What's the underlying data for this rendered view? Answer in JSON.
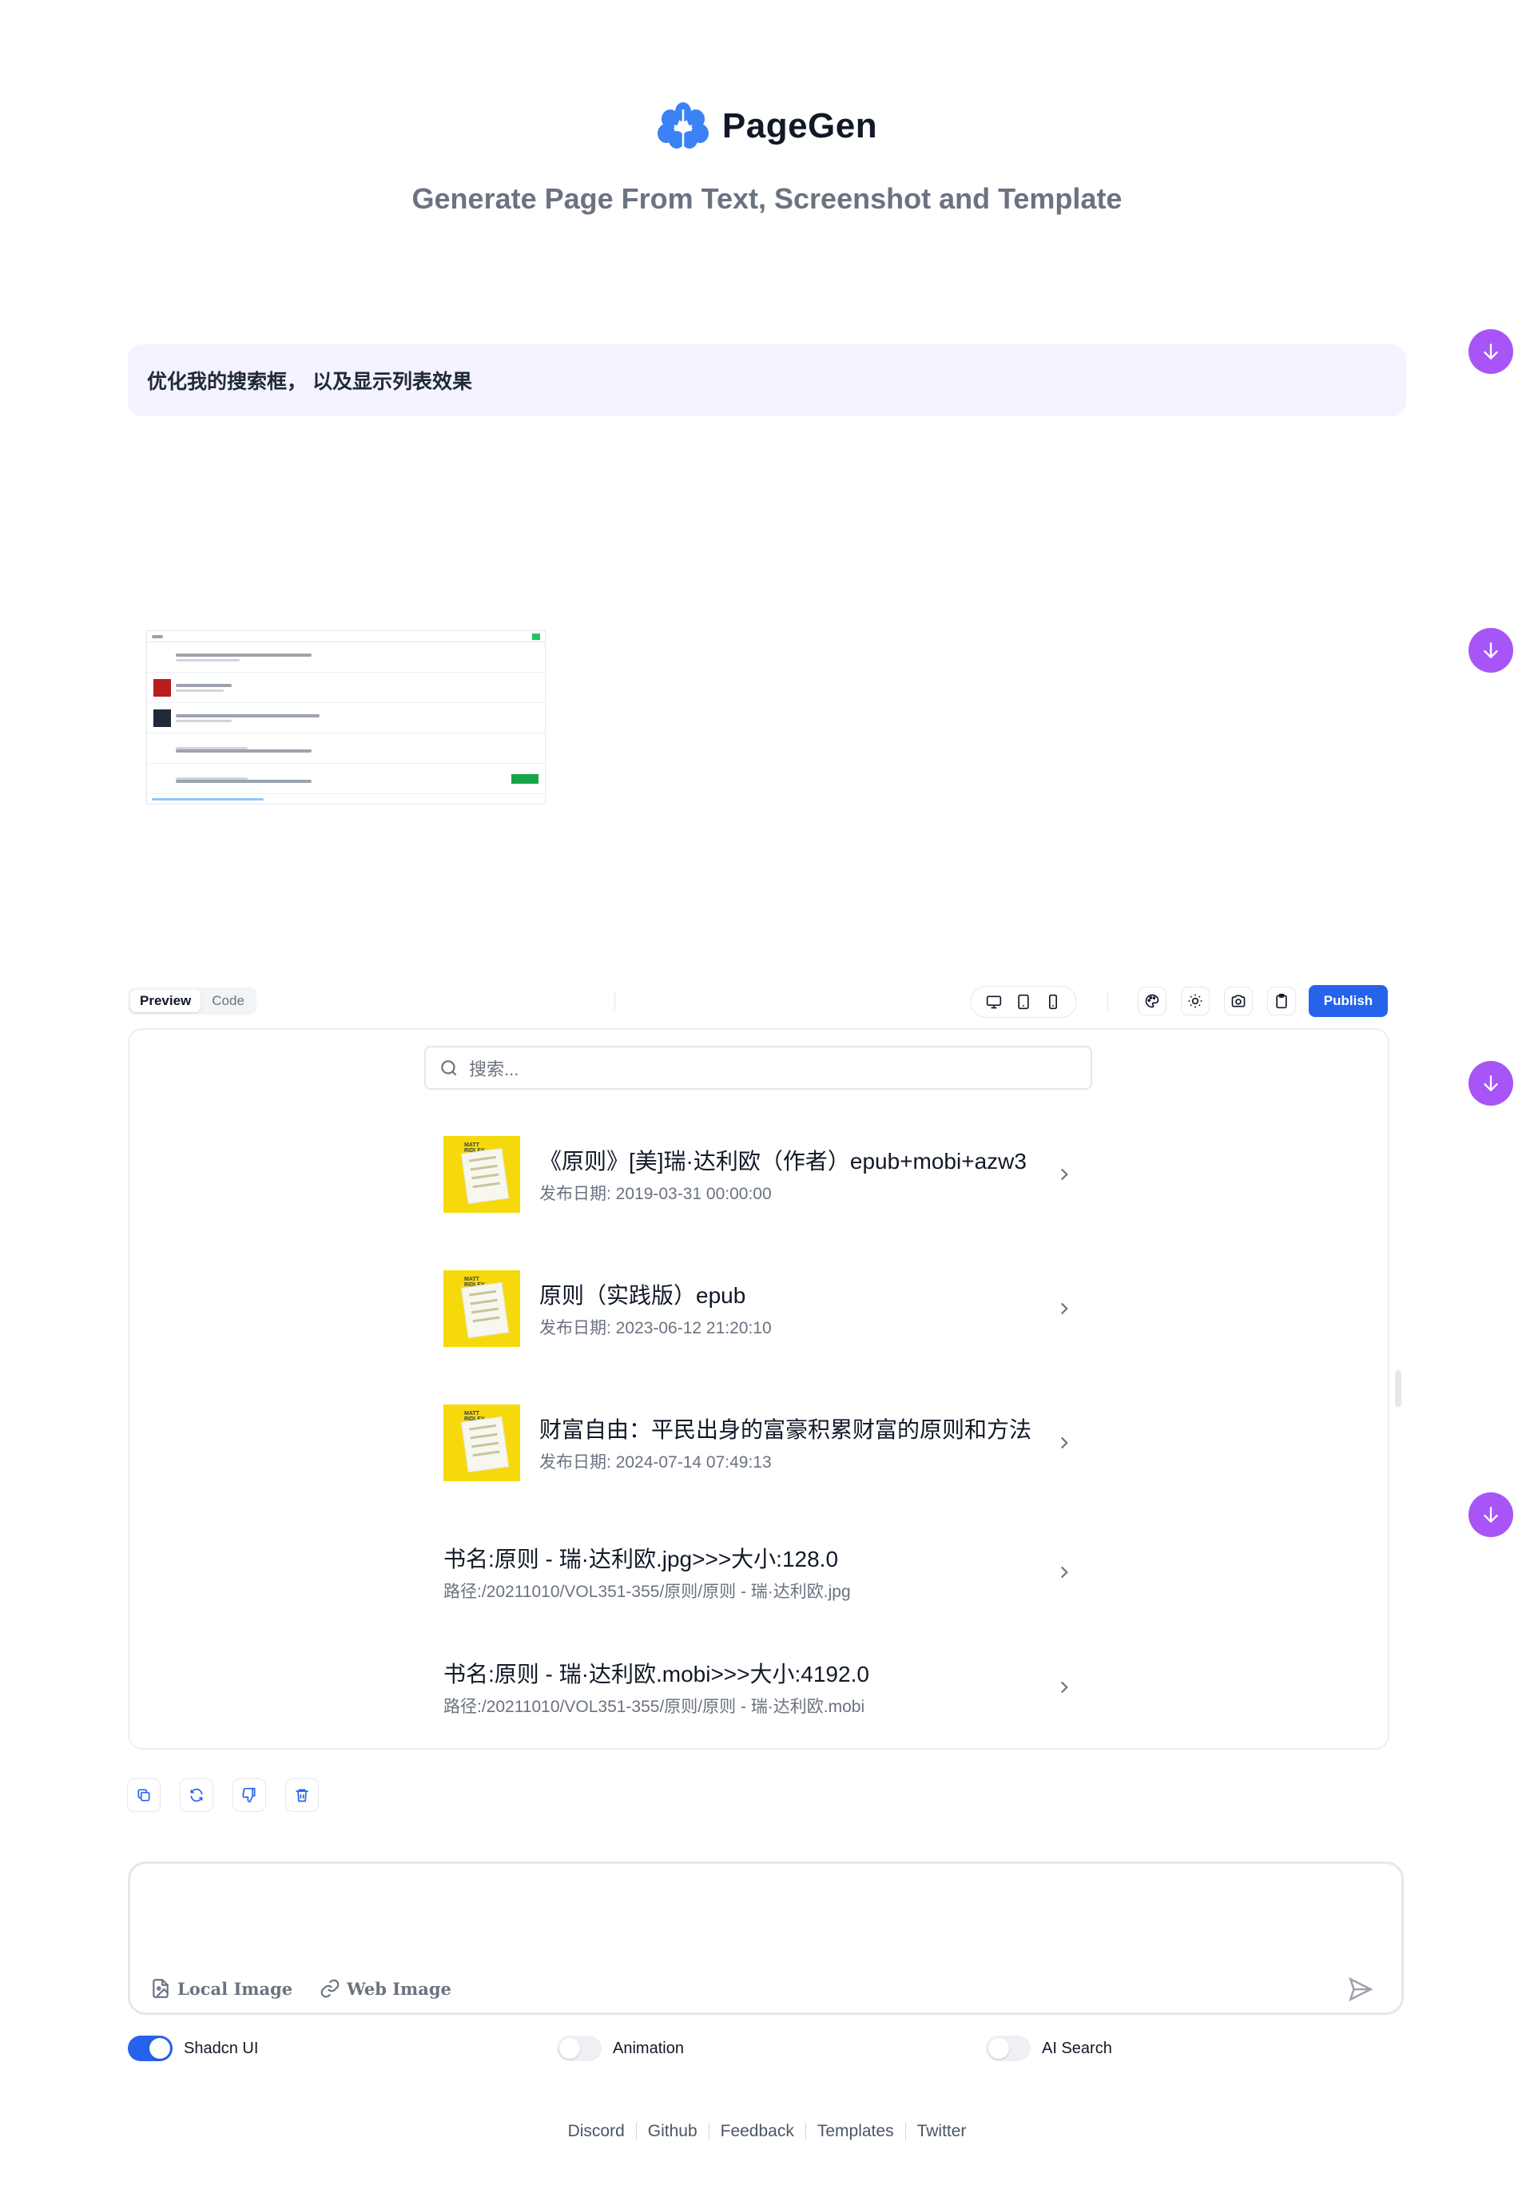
{
  "brand": {
    "name": "PageGen",
    "tagline": "Generate Page From Text, Screenshot and Template"
  },
  "prompt": {
    "text": "优化我的搜索框， 以及显示列表效果"
  },
  "toolbar": {
    "tabs": [
      {
        "label": "Preview",
        "active": true
      },
      {
        "label": "Code",
        "active": false
      }
    ],
    "devices": [
      "monitor-icon",
      "tablet-icon",
      "phone-icon"
    ],
    "tools": [
      "palette-icon",
      "sun-icon",
      "camera-icon",
      "clipboard-icon"
    ],
    "publish_label": "Publish"
  },
  "preview": {
    "search": {
      "placeholder": "搜索..."
    },
    "items": [
      {
        "title": "《原则》[美]瑞·达利欧（作者）epub+mobi+azw3",
        "subtitle": "发布日期: 2019-03-31 00:00:00",
        "has_cover": true
      },
      {
        "title": "原则（实践版）epub",
        "subtitle": "发布日期: 2023-06-12 21:20:10",
        "has_cover": true
      },
      {
        "title": "财富自由：平民出身的富豪积累财富的原则和方法",
        "subtitle": "发布日期: 2024-07-14 07:49:13",
        "has_cover": true
      },
      {
        "title": "书名:原则 - 瑞·达利欧.jpg>>>大小:128.0",
        "subtitle": "路径:/20211010/VOL351-355/原则/原则 - 瑞·达利欧.jpg",
        "has_cover": false
      },
      {
        "title": "书名:原则 - 瑞·达利欧.mobi>>>大小:4192.0",
        "subtitle": "路径:/20211010/VOL351-355/原则/原则 - 瑞·达利欧.mobi",
        "has_cover": false
      }
    ]
  },
  "actions": [
    "copy-icon",
    "refresh-icon",
    "thumbs-down-icon",
    "trash-icon"
  ],
  "composer": {
    "local_image_label": "Local Image",
    "web_image_label": "Web Image"
  },
  "toggles": [
    {
      "label": "Shadcn UI",
      "on": true
    },
    {
      "label": "Animation",
      "on": false
    },
    {
      "label": "AI Search",
      "on": false
    }
  ],
  "footer": {
    "links": [
      "Discord",
      "Github",
      "Feedback",
      "Templates",
      "Twitter"
    ]
  },
  "colors": {
    "accent": "#2563eb",
    "scroll_button": "#a855f7",
    "prompt_bg": "#f4f3ff",
    "cover_yellow": "#f5d90a"
  }
}
